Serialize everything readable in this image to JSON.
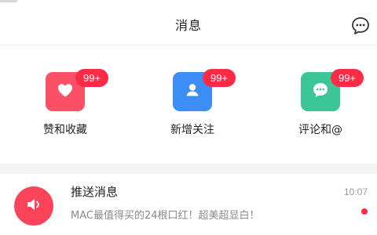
{
  "header": {
    "title": "消息",
    "chat_icon": "chat-bubble-icon"
  },
  "quick_actions": [
    {
      "label": "赞和收藏",
      "badge": "99+",
      "icon": "heart-icon",
      "color": "#fc5066"
    },
    {
      "label": "新增关注",
      "badge": "99+",
      "icon": "person-icon",
      "color": "#3a8ef6"
    },
    {
      "label": "评论和@",
      "badge": "99+",
      "icon": "comment-icon",
      "color": "#3cc597"
    }
  ],
  "messages": [
    {
      "title": "推送消息",
      "preview": "MAC最值得买的24根口红！超美超显白！",
      "time": "10:07",
      "icon": "speaker-icon",
      "unread": true
    }
  ],
  "colors": {
    "badge": "#ff2b46",
    "push_avatar": "#fb4459"
  }
}
